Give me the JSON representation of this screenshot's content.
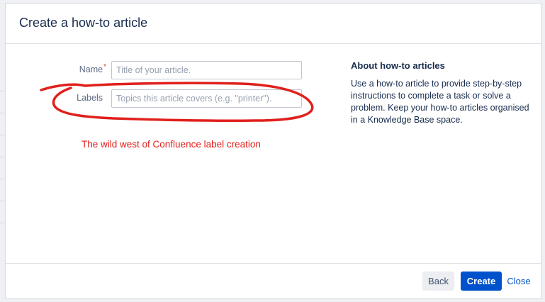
{
  "dialog": {
    "title": "Create a how-to article"
  },
  "form": {
    "name": {
      "label": "Name",
      "required_marker": "*",
      "value": "",
      "placeholder": "Title of your article."
    },
    "labels": {
      "label": "Labels",
      "value": "",
      "placeholder": "Topics this article covers (e.g. \"printer\")."
    }
  },
  "annotation": {
    "text": "The wild west of Confluence label creation",
    "color": "#e0201c"
  },
  "about": {
    "title": "About how-to articles",
    "body": "Use a how-to article to provide step-by-step instructions to complete a task or solve a problem. Keep your how-to articles organised in a Knowledge Base space."
  },
  "footer": {
    "back_label": "Back",
    "create_label": "Create",
    "close_label": "Close"
  },
  "colors": {
    "primary": "#0052cc",
    "text": "#172b4d",
    "required": "#de350b"
  }
}
